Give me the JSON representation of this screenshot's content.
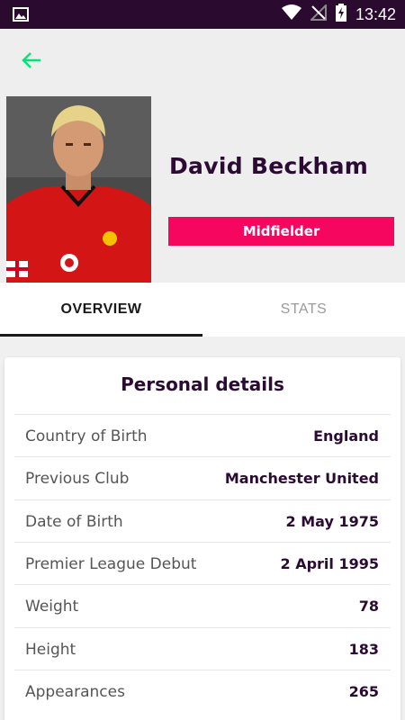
{
  "status_bar": {
    "time": "13:42",
    "icons": [
      "image-icon",
      "wifi-icon",
      "no-signal-icon",
      "battery-charging-icon"
    ]
  },
  "header": {
    "back_icon": "arrow-left-icon",
    "player_name": "David Beckham",
    "position": "Midfielder",
    "nationality_flag": "england-flag-icon"
  },
  "tabs": [
    {
      "label": "OVERVIEW",
      "active": true
    },
    {
      "label": "STATS",
      "active": false
    }
  ],
  "personal_details": {
    "title": "Personal details",
    "rows": [
      {
        "label": "Country of Birth",
        "value": "England"
      },
      {
        "label": "Previous Club",
        "value": "Manchester United"
      },
      {
        "label": "Date of Birth",
        "value": "2 May 1975"
      },
      {
        "label": "Premier League Debut",
        "value": "2 April 1995"
      },
      {
        "label": "Weight",
        "value": "78"
      },
      {
        "label": "Height",
        "value": "183"
      },
      {
        "label": "Appearances",
        "value": "265"
      }
    ]
  },
  "colors": {
    "status_bar_bg": "#2a0a2e",
    "accent_green": "#00ff85",
    "badge_pink": "#f5065f",
    "text_dark": "#2b0a33"
  }
}
